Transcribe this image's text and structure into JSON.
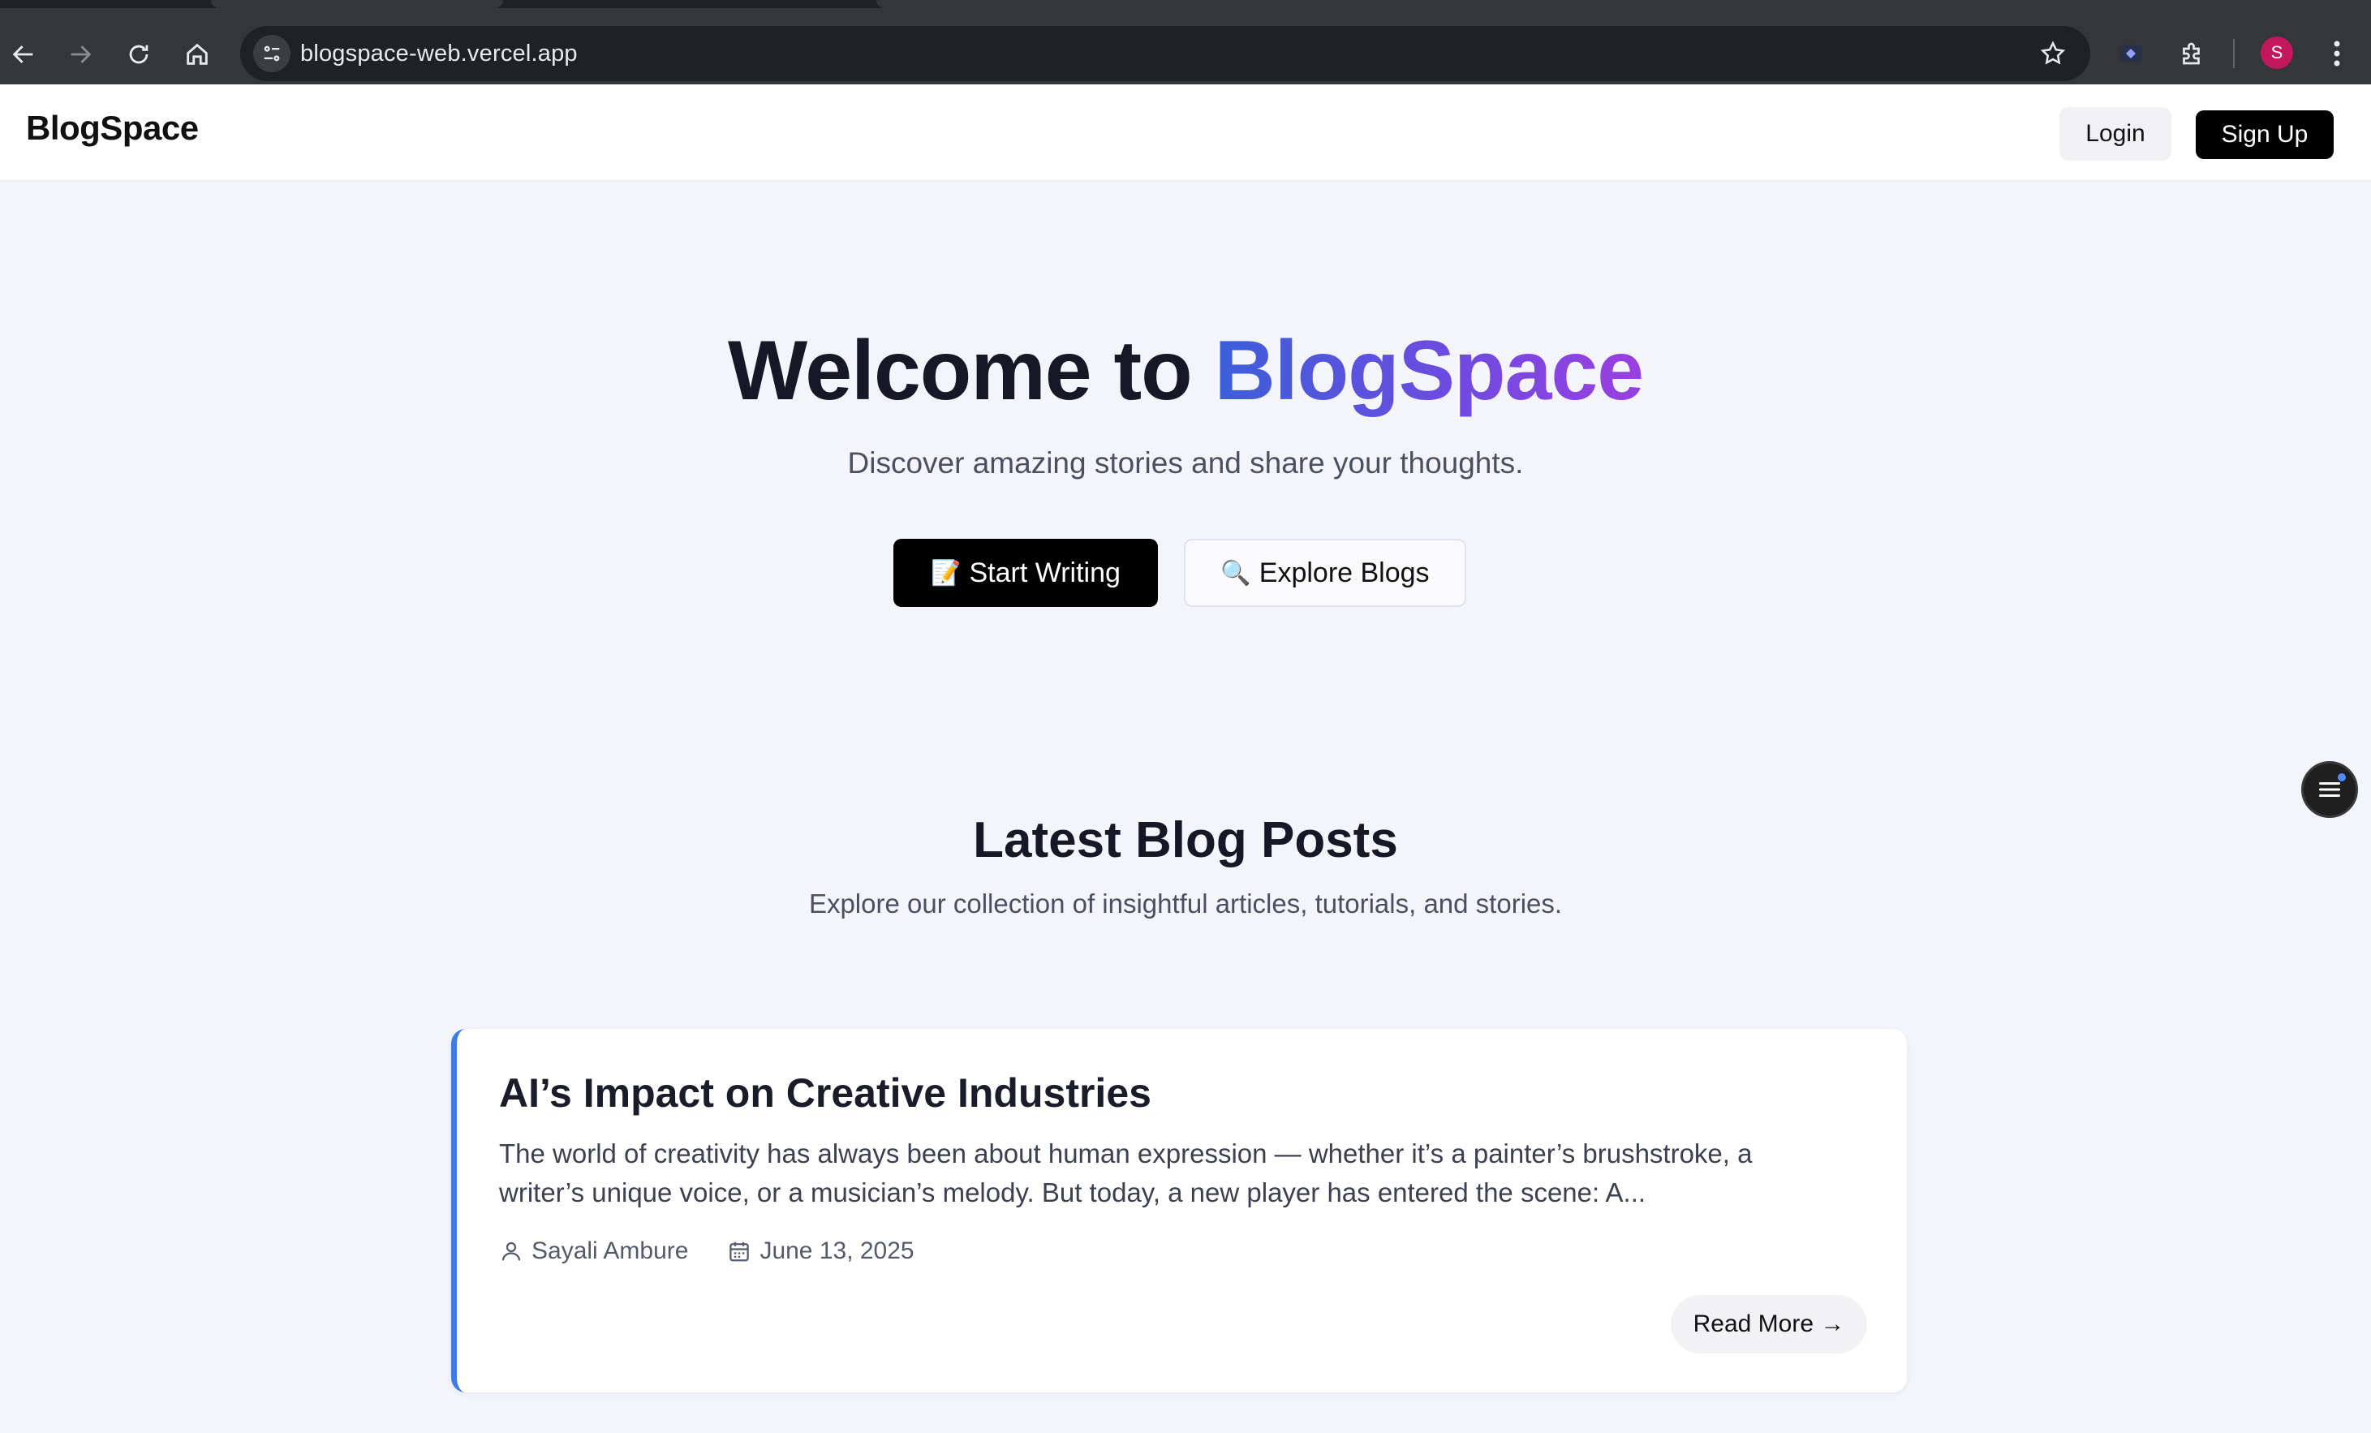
{
  "browser": {
    "url": "blogspace-web.vercel.app",
    "profile_initial": "S",
    "icons": [
      "back-icon",
      "forward-icon",
      "reload-icon",
      "home-icon",
      "site-info-icon",
      "bookmark-star-icon",
      "extension-icon",
      "puzzle-icon",
      "menu-kebab-icon"
    ]
  },
  "header": {
    "brand": "BlogSpace",
    "login_label": "Login",
    "signup_label": "Sign Up"
  },
  "hero": {
    "title_prefix": "Welcome to ",
    "title_accent": "BlogSpace",
    "subtitle": "Discover amazing stories and share your thoughts.",
    "start_emoji": "📝",
    "start_label": "Start Writing",
    "explore_emoji": "🔍",
    "explore_label": "Explore Blogs"
  },
  "latest": {
    "title": "Latest Blog Posts",
    "subtitle": "Explore our collection of insightful articles, tutorials, and stories.",
    "posts": [
      {
        "title": "AI’s Impact on Creative Industries",
        "excerpt": "The world of creativity has always been about human expression — whether it’s a painter’s brushstroke, a writer’s unique voice, or a musician’s melody. But today, a new player has entered the scene: A...",
        "author": "Sayali Ambure",
        "date": "June 13, 2025",
        "read_more": "Read More →"
      }
    ]
  },
  "colors": {
    "accent_blue": "#3b5fd9",
    "accent_purple": "#9a3fe0",
    "card_border": "#3f7be6",
    "background": "#f4f4fb"
  }
}
